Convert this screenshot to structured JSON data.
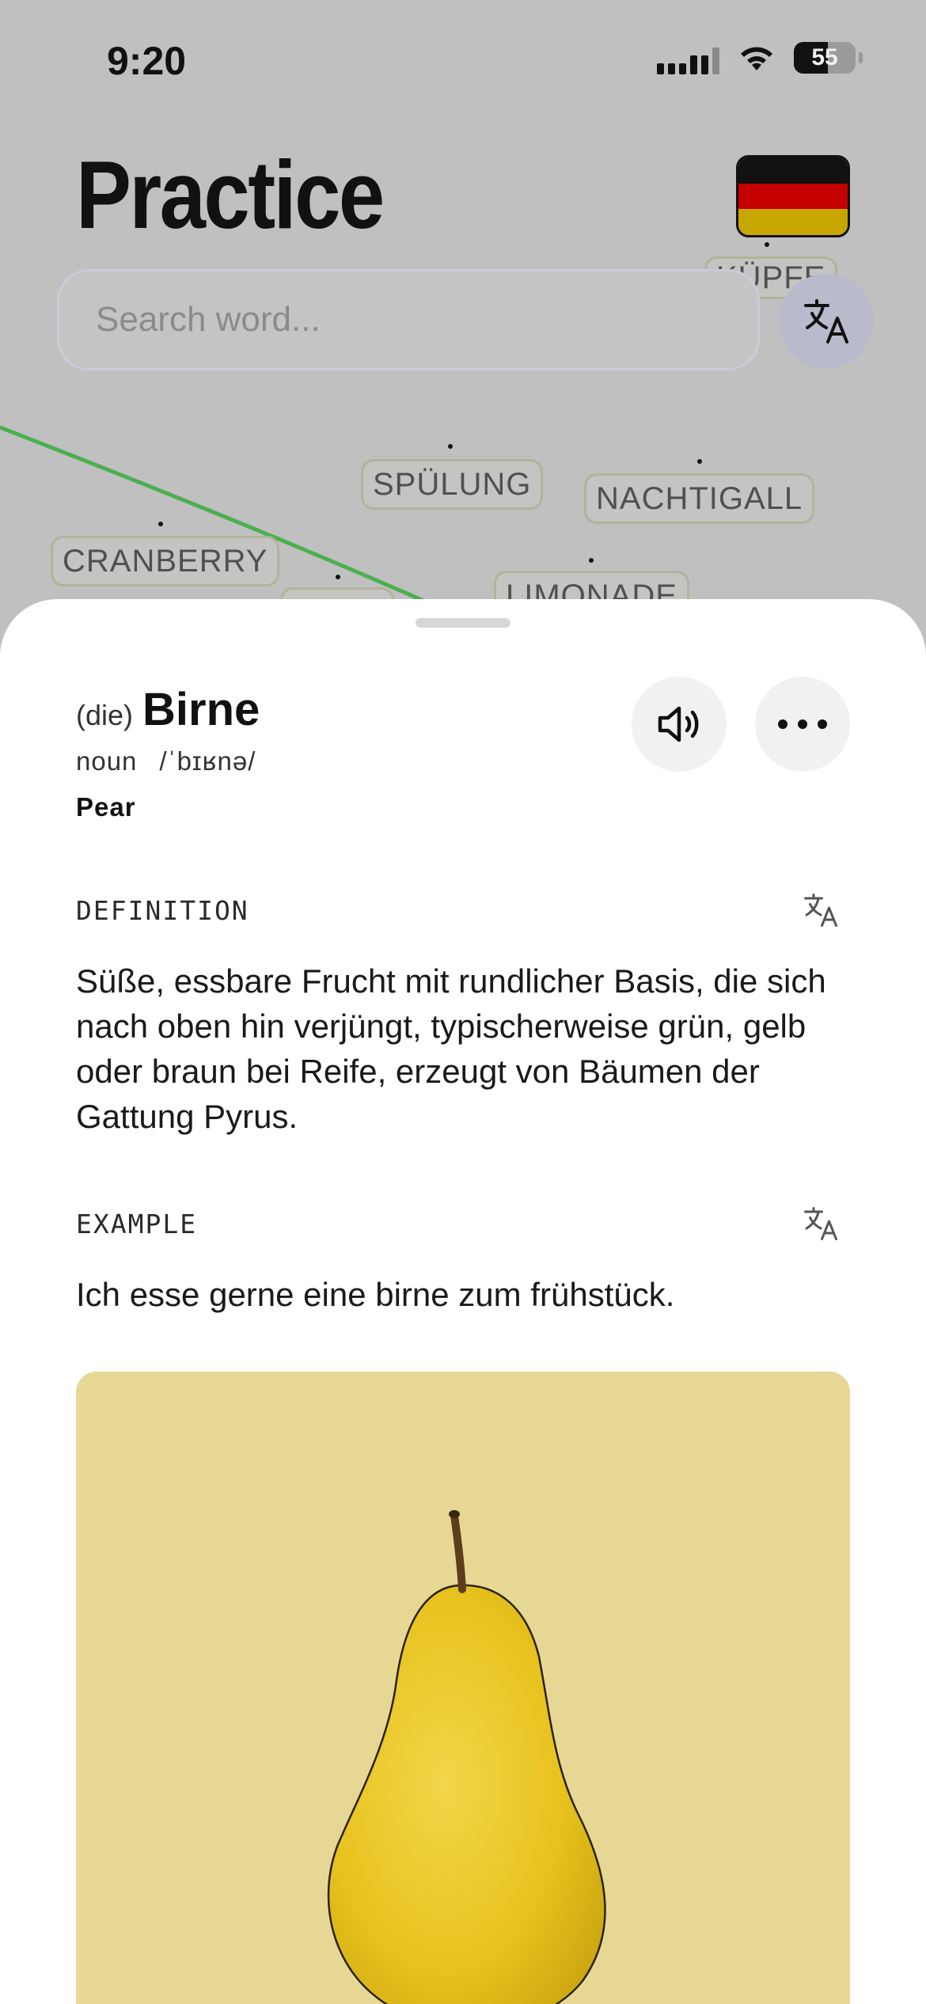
{
  "status_bar": {
    "time": "9:20",
    "battery": "55"
  },
  "header": {
    "title": "Practice",
    "flag_colors": [
      "#111111",
      "#cc0000",
      "#c9a800"
    ]
  },
  "search": {
    "placeholder": "Search word..."
  },
  "word_graph": {
    "chips": [
      "SPÜLUNG",
      "NACHTIGALL",
      "CRANBERRY",
      "LIMONADE",
      "KÜPFE"
    ],
    "link_color": "#4caf50"
  },
  "entry": {
    "article": "(die)",
    "word": "Birne",
    "part_of_speech": "noun",
    "ipa": "/ˈbɪʁnə/",
    "translation": "Pear",
    "definition_label": "DEFINITION",
    "definition": "Süße, essbare Frucht mit rundlicher Basis, die sich nach oben hin verjüngt, typischerweise grün, gelb oder braun bei Reife, erzeugt von Bäumen der Gattung Pyrus.",
    "example_label": "EXAMPLE",
    "example": "Ich esse gerne eine birne zum frühstück."
  },
  "icons": {
    "speaker": "speaker-icon",
    "more": "more-icon",
    "translate": "translate-icon"
  }
}
